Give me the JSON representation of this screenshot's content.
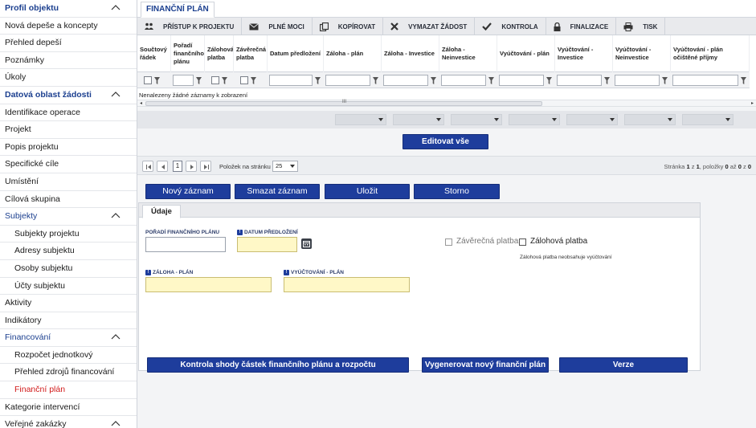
{
  "sidebar": {
    "items": [
      {
        "label": "Profil objektu",
        "type": "sec",
        "chevron": true
      },
      {
        "label": "Nová depeše a koncepty",
        "type": "normal"
      },
      {
        "label": "Přehled depeší",
        "type": "normal"
      },
      {
        "label": "Poznámky",
        "type": "normal"
      },
      {
        "label": "Úkoly",
        "type": "normal"
      },
      {
        "label": "Datová oblast žádosti",
        "type": "sec",
        "chevron": true
      },
      {
        "label": "Identifikace operace",
        "type": "normal"
      },
      {
        "label": "Projekt",
        "type": "normal"
      },
      {
        "label": "Popis projektu",
        "type": "normal"
      },
      {
        "label": "Specifické cíle",
        "type": "normal"
      },
      {
        "label": "Umístění",
        "type": "normal"
      },
      {
        "label": "Cílová skupina",
        "type": "normal"
      },
      {
        "label": "Subjekty",
        "type": "sec-plain",
        "chevron": true
      },
      {
        "label": "Subjekty projektu",
        "type": "sub"
      },
      {
        "label": "Adresy subjektu",
        "type": "sub"
      },
      {
        "label": "Osoby subjektu",
        "type": "sub"
      },
      {
        "label": "Účty subjektu",
        "type": "sub"
      },
      {
        "label": "Aktivity",
        "type": "normal"
      },
      {
        "label": "Indikátory",
        "type": "normal"
      },
      {
        "label": "Financování",
        "type": "sec-plain",
        "chevron": true
      },
      {
        "label": "Rozpočet jednotkový",
        "type": "sub"
      },
      {
        "label": "Přehled zdrojů financování",
        "type": "sub"
      },
      {
        "label": "Finanční plán",
        "type": "sub",
        "active": true
      },
      {
        "label": "Kategorie intervencí",
        "type": "normal"
      },
      {
        "label": "Veřejné zakázky",
        "type": "normal",
        "chevron": true
      }
    ]
  },
  "tabs": {
    "main": "FINANČNÍ PLÁN"
  },
  "toolbar": {
    "buttons": [
      {
        "label": "PŘÍSTUP K PROJEKTU",
        "icon": "users-icon"
      },
      {
        "label": "PLNÉ MOCI",
        "icon": "envelope-icon"
      },
      {
        "label": "KOPÍROVAT",
        "icon": "copy-icon"
      },
      {
        "label": "VYMAZAT ŽÁDOST",
        "icon": "x-icon"
      },
      {
        "label": "KONTROLA",
        "icon": "check-icon"
      },
      {
        "label": "FINALIZACE",
        "icon": "lock-icon"
      },
      {
        "label": "TISK",
        "icon": "printer-icon"
      }
    ]
  },
  "grid": {
    "columns": [
      "Součtový řádek",
      "Pořadí finančního plánu",
      "Zálohová platba",
      "Závěrečná platba",
      "Datum předložení",
      "Záloha - plán",
      "Záloha - Investice",
      "Záloha - Neinvestice",
      "Vyúčtování - plán",
      "Vyúčtování - Investice",
      "Vyúčtování - Neinvestice",
      "Vyúčtování - plán očištěné příjmy"
    ],
    "no_records": "Nenalezeny žádné záznamy k zobrazení",
    "scroll_thumb": "III"
  },
  "actions": {
    "edit_all": "Editovat vše",
    "new_record": "Nový záznam",
    "delete_record": "Smazat záznam",
    "save": "Uložit",
    "cancel": "Storno"
  },
  "pager": {
    "current_page": "1",
    "items_per_page_label": "Položek na stránku",
    "page_size": "25",
    "info_prefix": "Stránka",
    "info_page": "1",
    "info_of": "z",
    "info_total_pages": "1",
    "info_items": ", položky",
    "info_from": "0",
    "info_to_label": "až",
    "info_to": "0",
    "info_z2": "z",
    "info_total": "0"
  },
  "form": {
    "tab": "Údaje",
    "poradi_label": "POŘADÍ FINANČNÍHO PLÁNU",
    "datum_label": "DATUM PŘEDLOŽENÍ",
    "zaverecna_label": "Závěrečná platba",
    "zalohova_label": "Zálohová platba",
    "zalohova_note": "Zálohová platba neobsahuje vyúčtování",
    "zaloha_plan_label": "ZÁLOHA - PLÁN",
    "vyuctovani_plan_label": "VYÚČTOVÁNÍ - PLÁN",
    "req_mark": "!"
  },
  "bottom": {
    "check": "Kontrola shody částek finančního plánu a rozpočtu",
    "generate": "Vygenerovat nový finanční plán",
    "versions": "Verze"
  }
}
